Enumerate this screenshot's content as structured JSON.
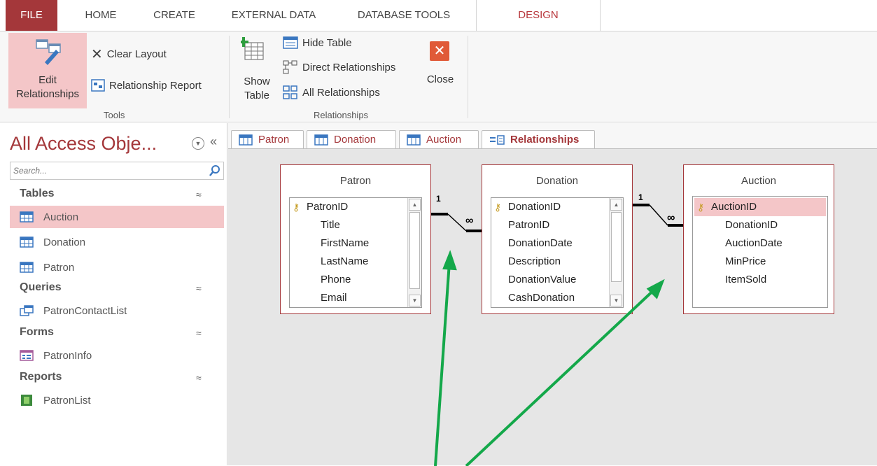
{
  "ribbon_tabs": [
    "FILE",
    "HOME",
    "CREATE",
    "EXTERNAL DATA",
    "DATABASE TOOLS",
    "DESIGN"
  ],
  "ribbon": {
    "tools": {
      "edit_relationships": [
        "Edit",
        "Relationships"
      ],
      "clear_layout": "Clear Layout",
      "relationship_report": "Relationship Report",
      "group_label": "Tools"
    },
    "relationships": {
      "show_table": [
        "Show",
        "Table"
      ],
      "hide_table": "Hide Table",
      "direct_relationships": "Direct Relationships",
      "all_relationships": "All Relationships",
      "close": "Close",
      "group_label": "Relationships"
    }
  },
  "nav": {
    "title": "All Access Obje...",
    "search_placeholder": "Search...",
    "sections": [
      {
        "heading": "Tables",
        "items": [
          "Auction",
          "Donation",
          "Patron"
        ]
      },
      {
        "heading": "Queries",
        "items": [
          "PatronContactList"
        ]
      },
      {
        "heading": "Forms",
        "items": [
          "PatronInfo"
        ]
      },
      {
        "heading": "Reports",
        "items": [
          "PatronList"
        ]
      }
    ]
  },
  "doc_tabs": [
    "Patron",
    "Donation",
    "Auction",
    "Relationships"
  ],
  "tables": {
    "patron": {
      "title": "Patron",
      "fields": [
        "PatronID",
        "Title",
        "FirstName",
        "LastName",
        "Phone",
        "Email"
      ]
    },
    "donation": {
      "title": "Donation",
      "fields": [
        "DonationID",
        "PatronID",
        "DonationDate",
        "Description",
        "DonationValue",
        "CashDonation"
      ]
    },
    "auction": {
      "title": "Auction",
      "fields": [
        "AuctionID",
        "DonationID",
        "AuctionDate",
        "MinPrice",
        "ItemSold"
      ]
    }
  },
  "relationship_labels": {
    "one": "1",
    "many": "∞"
  },
  "colors": {
    "accent": "#a4373a",
    "selection": "#f4c6c8",
    "annotation_arrow": "#14a84a"
  }
}
